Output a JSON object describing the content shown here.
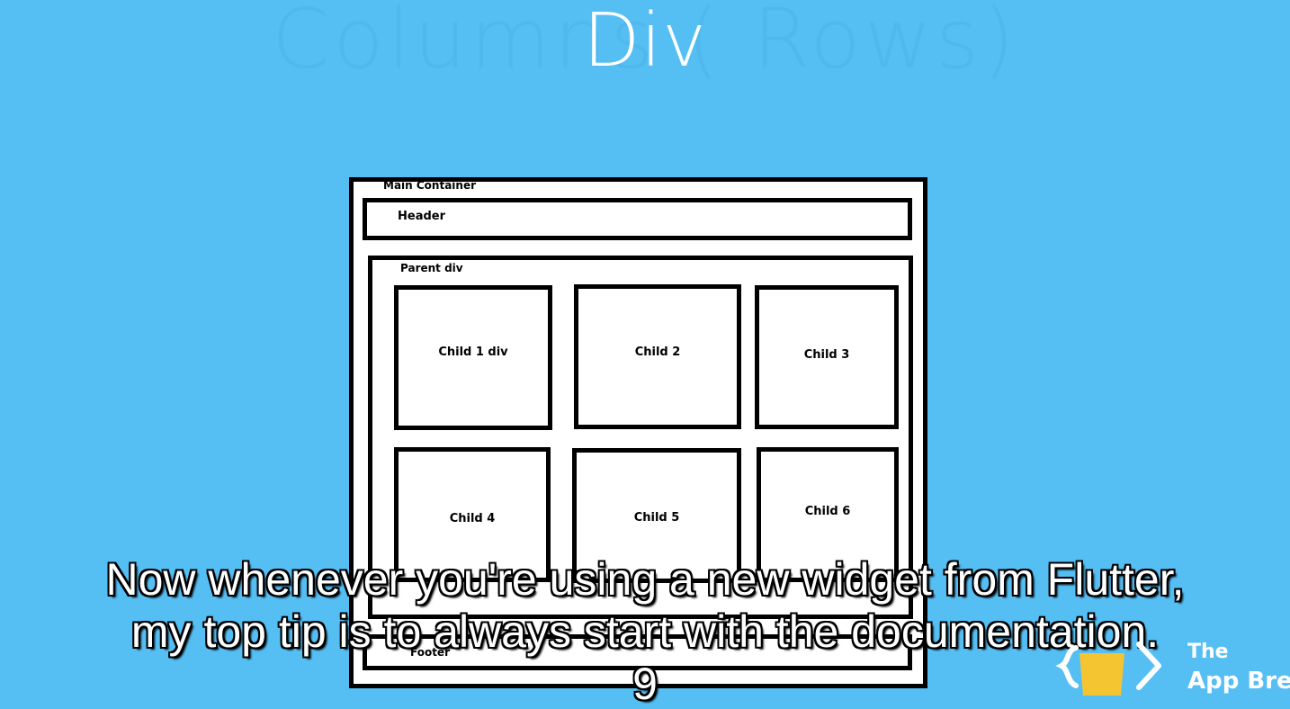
{
  "slide": {
    "title": "Div",
    "background_title": "Columns (   Rows)"
  },
  "diagram": {
    "main_container_label": "Main Container",
    "header_label": "Header",
    "parent_label": "Parent div",
    "children": [
      "Child 1 div",
      "Child 2",
      "Child 3",
      "Child 4",
      "Child 5",
      "Child 6"
    ],
    "footer_label": "Footer"
  },
  "caption": {
    "line1": "Now whenever you're using a new widget from Flutter,",
    "line2": "my top tip is to always start with the documentation.",
    "line3": "9"
  },
  "logo": {
    "the": "The",
    "name": "App Bre"
  },
  "colors": {
    "background": "#55bff4",
    "title": "#ffffff",
    "logo_accent": "#f5c431"
  }
}
